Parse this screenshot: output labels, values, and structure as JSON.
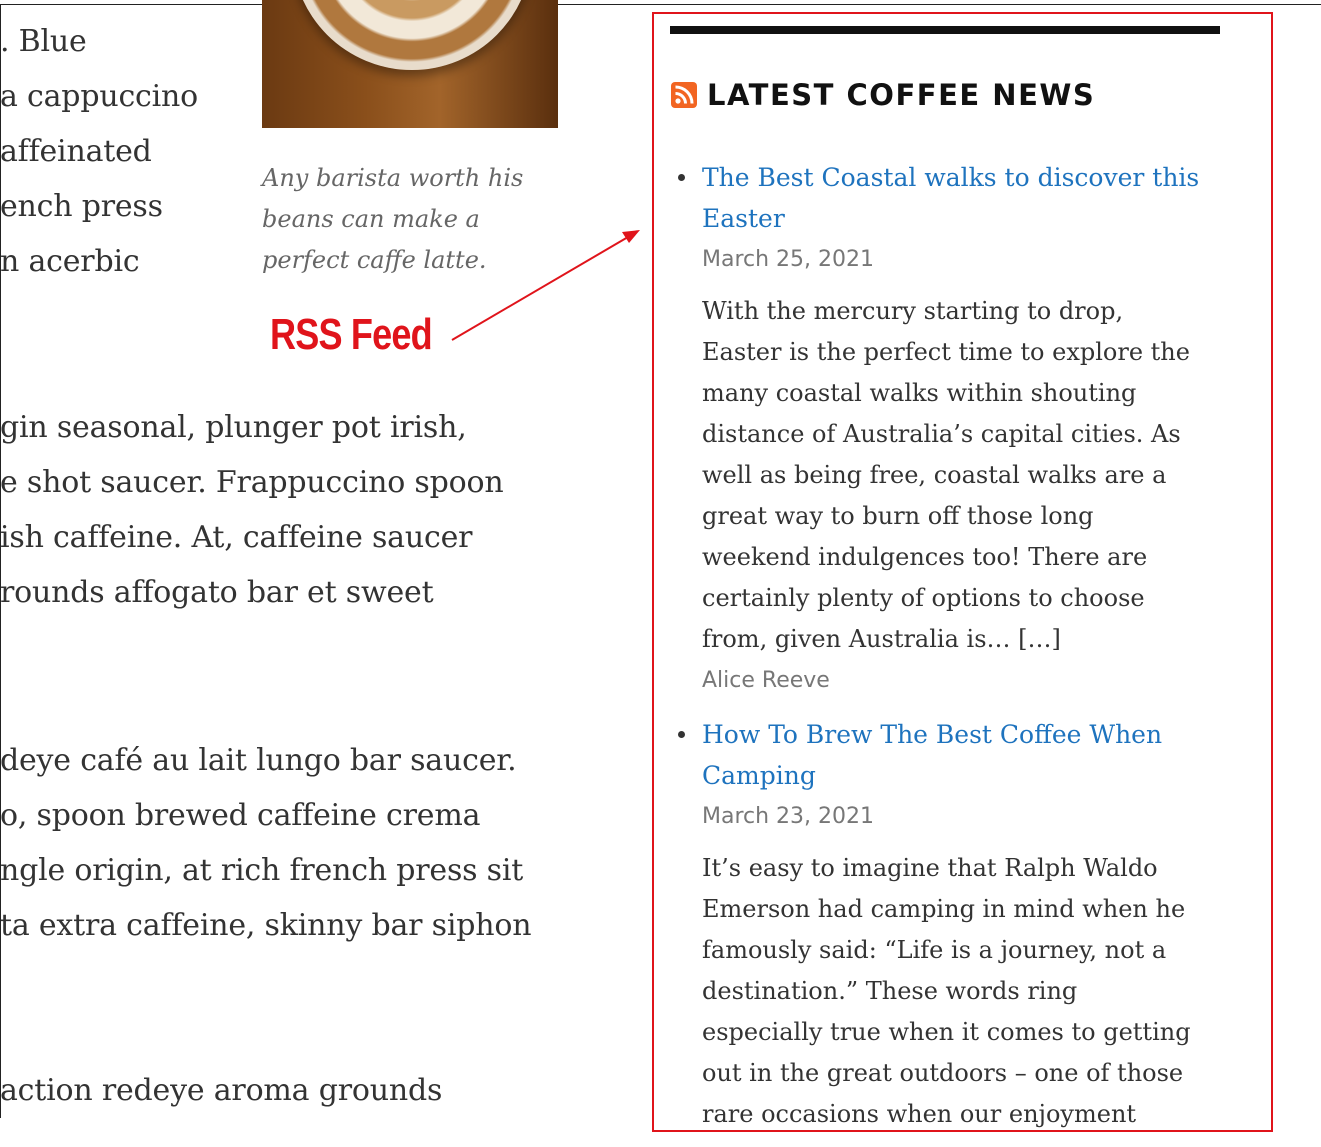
{
  "article": {
    "paragraph1": [
      ". Blue",
      "a cappuccino",
      "affeinated",
      "ench press",
      "n acerbic"
    ],
    "paragraph2": [
      "gin seasonal, plunger pot irish,",
      "e shot saucer. Frappuccino spoon",
      "ish caffeine. At, caffeine saucer",
      "rounds affogato bar et sweet"
    ],
    "paragraph3": [
      "deye café au lait lungo bar saucer.",
      "o, spoon brewed caffeine crema",
      "ngle origin, at rich french press sit",
      "ta extra caffeine, skinny bar siphon"
    ],
    "paragraph4": [
      "action redeye aroma grounds"
    ],
    "figure_caption": [
      "Any barista worth his",
      "beans can make a",
      "perfect caffe latte."
    ]
  },
  "annotation": {
    "label": "RSS Feed",
    "color": "#e0141b"
  },
  "widget": {
    "title": "LATEST COFFEE NEWS",
    "icon": "rss-icon",
    "border_color": "#e0141b",
    "link_color": "#1e73be",
    "items": [
      {
        "title": "The Best Coastal walks to discover this Easter",
        "date": "March 25, 2021",
        "excerpt_lines": [
          "With the mercury starting to drop,",
          "Easter is the perfect time to explore the",
          "many coastal walks within shouting",
          "distance of Australia’s capital cities. As",
          "well as being free, coastal walks are a",
          "great way to burn off those long",
          "weekend indulgences too! There are",
          "certainly plenty of options to choose",
          "from, given Australia is… […]"
        ],
        "author": "Alice Reeve"
      },
      {
        "title": "How To Brew The Best Coffee When Camping",
        "date": "March 23, 2021",
        "excerpt_lines": [
          "It’s easy to imagine that Ralph Waldo",
          "Emerson had camping in mind when he",
          "famously said: “Life is a journey, not a",
          "destination.” These words ring",
          "especially true when it comes to getting",
          "out in the great outdoors – one of those",
          "rare occasions when our enjoyment"
        ]
      }
    ]
  }
}
